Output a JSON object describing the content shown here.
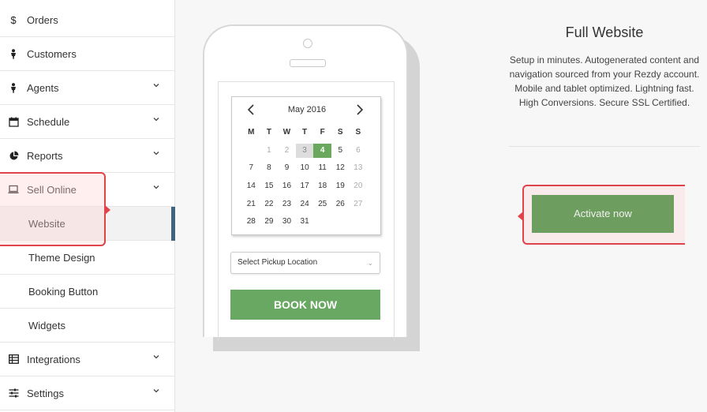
{
  "sidebar": {
    "items": [
      {
        "label": "Orders",
        "icon": "dollar-icon"
      },
      {
        "label": "Customers",
        "icon": "person-icon"
      },
      {
        "label": "Agents",
        "icon": "person-icon"
      },
      {
        "label": "Schedule",
        "icon": "calendar-icon"
      },
      {
        "label": "Reports",
        "icon": "pie-chart-icon"
      },
      {
        "label": "Sell Online",
        "icon": "laptop-icon"
      },
      {
        "label": "Integrations",
        "icon": "table-icon"
      },
      {
        "label": "Settings",
        "icon": "sliders-icon"
      }
    ],
    "sub_items": [
      {
        "label": "Website",
        "active": true
      },
      {
        "label": "Theme Design"
      },
      {
        "label": "Booking Button"
      },
      {
        "label": "Widgets"
      }
    ]
  },
  "phone": {
    "calendar": {
      "month_label": "May 2016",
      "weekdays": [
        "M",
        "T",
        "W",
        "T",
        "F",
        "S",
        "S"
      ],
      "weeks": [
        [
          "",
          "1",
          "2",
          "3",
          "4",
          "5",
          "6"
        ],
        [
          "7",
          "8",
          "9",
          "10",
          "11",
          "12",
          "13"
        ],
        [
          "14",
          "15",
          "16",
          "17",
          "18",
          "19",
          "20"
        ],
        [
          "21",
          "22",
          "23",
          "24",
          "25",
          "26",
          "27"
        ],
        [
          "28",
          "29",
          "30",
          "31",
          "",
          "",
          ""
        ]
      ],
      "today": "3",
      "selected": "4"
    },
    "pickup_placeholder": "Select Pickup Location",
    "book_label": "BOOK NOW"
  },
  "panel": {
    "title": "Full Website",
    "description": "Setup in minutes. Autogenerated content and navigation sourced from your Rezdy account. Mobile and tablet optimized. Lightning fast. High Conversions. Secure SSL Certified.",
    "activate_label": "Activate now"
  },
  "colors": {
    "accent_green": "#69a862",
    "active_bar": "#3e6480",
    "callout_red": "#e0444a"
  }
}
